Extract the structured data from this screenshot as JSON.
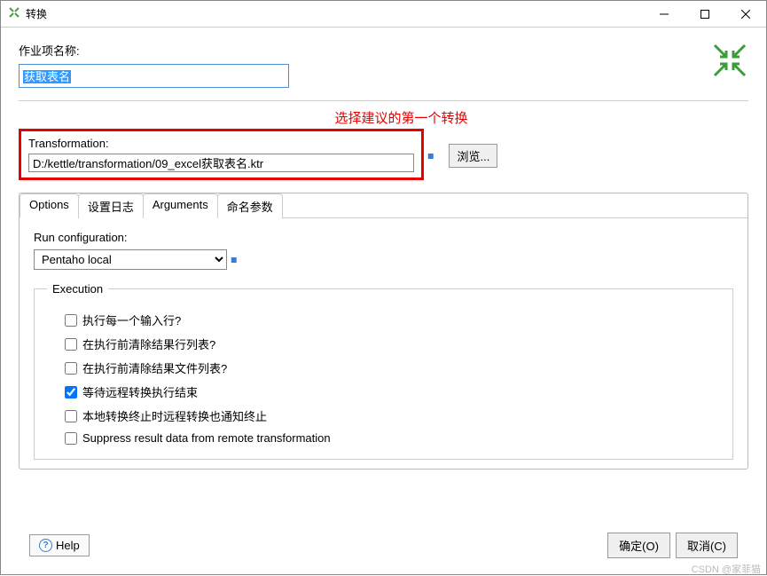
{
  "window": {
    "title": "转换",
    "name_label": "作业项名称:",
    "name_value": "获取表名",
    "annotation": "选择建议的第一个转换",
    "transformation_label": "Transformation:",
    "transformation_path": "D:/kettle/transformation/09_excel获取表名.ktr",
    "browse_label": "浏览..."
  },
  "tabs": {
    "options": "Options",
    "log": "设置日志",
    "arguments": "Arguments",
    "params": "命名参数"
  },
  "options": {
    "runcfg_label": "Run configuration:",
    "runcfg_value": "Pentaho local",
    "execution_legend": "Execution",
    "checks": [
      {
        "label": "执行每一个输入行?",
        "checked": false
      },
      {
        "label": "在执行前清除结果行列表?",
        "checked": false
      },
      {
        "label": "在执行前清除结果文件列表?",
        "checked": false
      },
      {
        "label": "等待远程转换执行结束",
        "checked": true
      },
      {
        "label": "本地转换终止时远程转换也通知终止",
        "checked": false
      },
      {
        "label": "Suppress result data from remote transformation",
        "checked": false
      }
    ]
  },
  "footer": {
    "help": "Help",
    "ok": "确定(O)",
    "cancel": "取消(C)"
  },
  "watermark": "CSDN @家菲猫"
}
